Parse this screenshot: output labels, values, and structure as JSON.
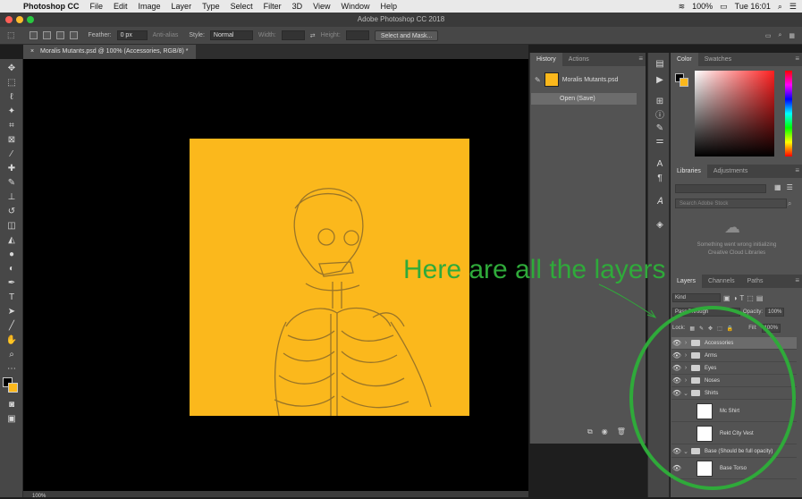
{
  "menubar": {
    "app": "Photoshop CC",
    "items": [
      "File",
      "Edit",
      "Image",
      "Layer",
      "Type",
      "Select",
      "Filter",
      "3D",
      "View",
      "Window",
      "Help"
    ],
    "battery": "100%",
    "clock": "Tue 16:01"
  },
  "window": {
    "title": "Adobe Photoshop CC 2018"
  },
  "options": {
    "feather_label": "Feather:",
    "feather_value": "0 px",
    "antialias": "Anti-alias",
    "style_label": "Style:",
    "style_value": "Normal",
    "width_label": "Width:",
    "height_label": "Height:",
    "select_mask": "Select and Mask..."
  },
  "document": {
    "tab": "Moralis Mutants.psd @ 100% (Accessories, RGB/8) *"
  },
  "annotation": {
    "text": "Here are all the layers"
  },
  "history": {
    "tabs": [
      "History",
      "Actions"
    ],
    "snapshot": "Moralis Mutants.psd",
    "step": "Open (Save)"
  },
  "color": {
    "tabs": [
      "Color",
      "Swatches"
    ],
    "fg": "#000000",
    "bg": "#fbb81c"
  },
  "libraries": {
    "tabs": [
      "Libraries",
      "Adjustments"
    ],
    "search_placeholder": "Search Adobe Stock",
    "error_line1": "Something went wrong initializing",
    "error_line2": "Creative Cloud Libraries"
  },
  "layers": {
    "tabs": [
      "Layers",
      "Channels",
      "Paths"
    ],
    "kind": "Kind",
    "blend": "Pass Through",
    "opacity_label": "Opacity:",
    "opacity": "100%",
    "lock_label": "Lock:",
    "fill_label": "Fill:",
    "fill": "100%",
    "groups": [
      "Accessories",
      "Arms",
      "Eyes",
      "Noses",
      "Shirts"
    ],
    "shirt_layers": [
      "Mc Shirt",
      "Rekt City Vest"
    ],
    "base_group": "Base (Should be full opacity)",
    "base_layers": [
      "Base Torso"
    ]
  },
  "status": {
    "zoom": "100%"
  },
  "colors": {
    "accent_green": "#2faa3a",
    "canvas_orange": "#fbb81c"
  }
}
